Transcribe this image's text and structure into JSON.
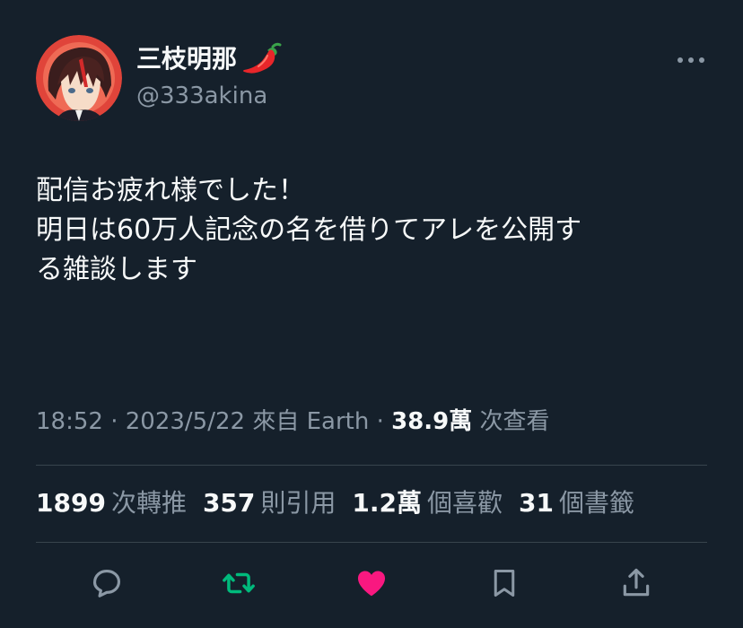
{
  "author": {
    "display_name": "三枝明那",
    "handle": "@333akina",
    "name_emoji": "chili-pepper-icon"
  },
  "tweet": {
    "lines": [
      "配信お疲れ様でした！",
      "明日は60万人記念の名を借りてアレを公開す",
      "る雑談します"
    ]
  },
  "meta": {
    "time": "18:52",
    "separator": "·",
    "date": "2023/5/22",
    "source": "來自 Earth",
    "views_count": "38.9萬",
    "views_label": "次查看"
  },
  "stats": {
    "retweets_count": "1899",
    "retweets_label": "次轉推",
    "quotes_count": "357",
    "quotes_label": "則引用",
    "likes_count": "1.2萬",
    "likes_label": "個喜歡",
    "bookmarks_count": "31",
    "bookmarks_label": "個書籤"
  },
  "actions": [
    "reply-icon",
    "retweet-icon",
    "like-icon",
    "bookmark-icon",
    "share-icon"
  ],
  "colors": {
    "background": "#15202b",
    "text": "#f7f9f9",
    "secondary": "#8b98a5",
    "divider": "#38444d",
    "retweet_active": "#00ba7c",
    "like_active": "#f91880"
  }
}
